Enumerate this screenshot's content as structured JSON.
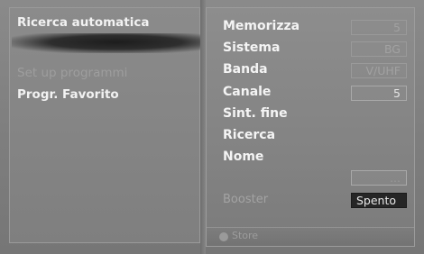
{
  "menu": {
    "items": [
      {
        "label": "Ricerca automatica",
        "state": "selected"
      },
      {
        "label": "Set up programmi",
        "state": "disabled"
      },
      {
        "label": "Progr. Favorito",
        "state": "normal"
      }
    ]
  },
  "settings": {
    "rows": [
      {
        "label": "Memorizza",
        "value": "5"
      },
      {
        "label": "Sistema",
        "value": "BG"
      },
      {
        "label": "Banda",
        "value": "V/UHF"
      },
      {
        "label": "Canale",
        "value": "5"
      },
      {
        "label": "Sint.  fine",
        "value": ""
      },
      {
        "label": "Ricerca",
        "value": ""
      },
      {
        "label": "Nome",
        "value": ""
      }
    ],
    "blank_box_value": "...",
    "booster": {
      "label": "Booster",
      "value": "Spento"
    }
  },
  "footer": {
    "store_label": "Store"
  },
  "colors": {
    "background": "#7e7e7e",
    "selected_value_bg": "#262626",
    "text_primary": "#f4f4f4",
    "text_dim": "#a2a2a2"
  }
}
